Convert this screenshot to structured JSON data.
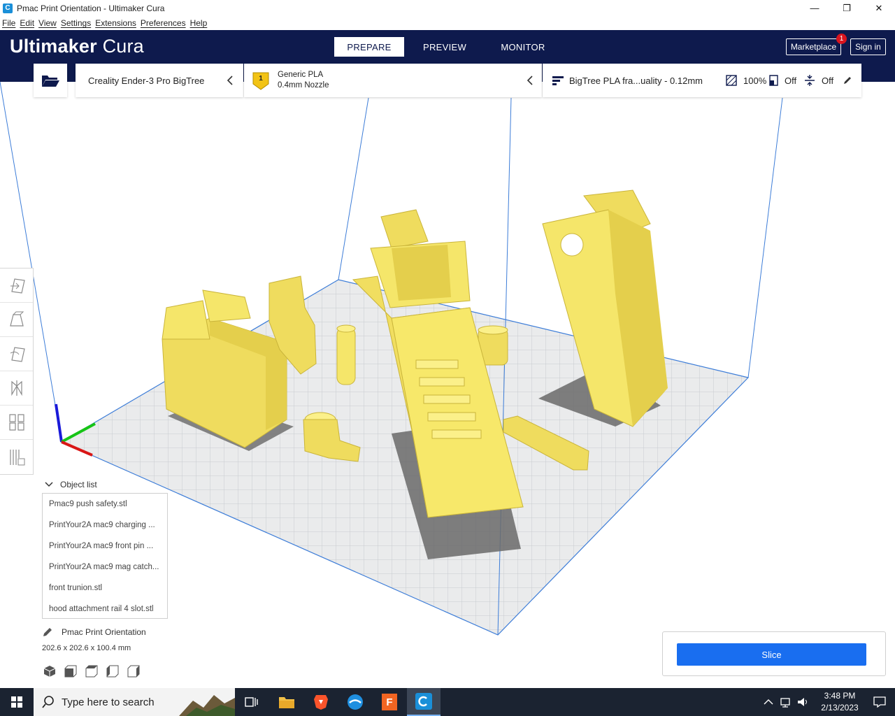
{
  "window": {
    "title": "Pmac Print Orientation - Ultimaker Cura",
    "controls": [
      "—",
      "❐",
      "✕"
    ]
  },
  "menubar": [
    "File",
    "Edit",
    "View",
    "Settings",
    "Extensions",
    "Preferences",
    "Help"
  ],
  "header": {
    "logo_brand": "Ultimaker",
    "logo_product": "Cura",
    "tabs": [
      {
        "label": "PREPARE",
        "active": true
      },
      {
        "label": "PREVIEW",
        "active": false
      },
      {
        "label": "MONITOR",
        "active": false
      }
    ],
    "marketplace_label": "Marketplace",
    "marketplace_badge": "1",
    "signin_label": "Sign in"
  },
  "stage": {
    "printer_name": "Creality Ender-3 Pro BigTree",
    "extruder_number": "1",
    "material_name": "Generic PLA",
    "nozzle": "0.4mm Nozzle",
    "profile": "BigTree PLA fra...uality - 0.12mm",
    "infill": "100%",
    "support": "Off",
    "adhesion": "Off"
  },
  "object_list": {
    "title": "Object list",
    "items": [
      "Pmac9 push safety.stl",
      "PrintYour2A mac9 charging ...",
      "PrintYour2A mac9 front pin ...",
      "PrintYour2A mac9 mag catch...",
      "front trunion.stl",
      "hood attachment rail 4 slot.stl"
    ]
  },
  "project": {
    "name": "Pmac Print Orientation",
    "dimensions": "202.6 x 202.6 x 100.4 mm"
  },
  "slice": {
    "label": "Slice"
  },
  "taskbar": {
    "search_placeholder": "Type here to search",
    "time": "3:48 PM",
    "date": "2/13/2023",
    "fusion_label": "F"
  },
  "colors": {
    "header_bg": "#0e1a4d",
    "accent_blue": "#196ef0",
    "model_yellow": "#f7e86a",
    "badge_red": "#d9141e"
  }
}
